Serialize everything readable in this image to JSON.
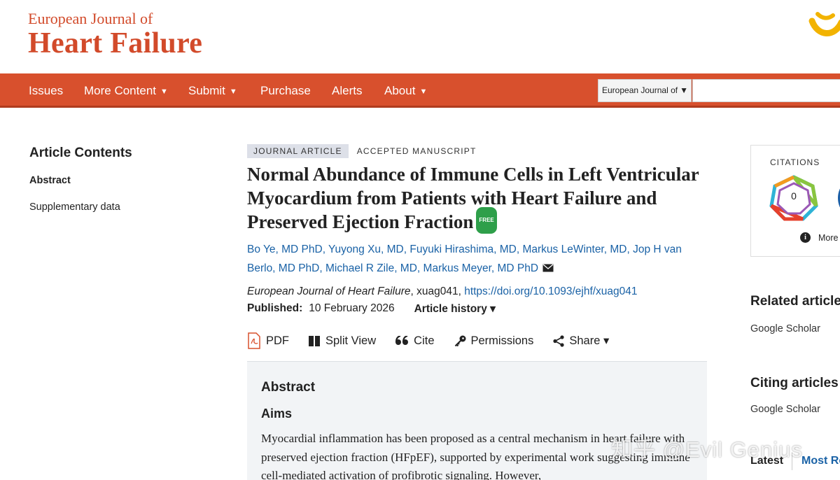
{
  "header": {
    "logo_small": "European Journal of",
    "logo_big": "Heart Failure"
  },
  "nav": {
    "items": [
      {
        "label": "Issues"
      },
      {
        "label": "More Content"
      },
      {
        "label": "Submit"
      },
      {
        "label": "Purchase"
      },
      {
        "label": "Alerts"
      },
      {
        "label": "About"
      }
    ],
    "search_scope": "European Journal of",
    "search_value": ""
  },
  "toc": {
    "title": "Article Contents",
    "items": [
      "Abstract",
      "Supplementary data"
    ]
  },
  "article": {
    "badge_type": "JOURNAL ARTICLE",
    "badge_status": "ACCEPTED MANUSCRIPT",
    "title": "Normal Abundance of Immune Cells in Left Ventricular Myocardium from Patients with Heart Failure and Preserved Ejection Fraction",
    "free_label": "FREE",
    "authors": [
      "Bo Ye, MD PhD",
      "Yuyong Xu, MD",
      "Fuyuki Hirashima, MD",
      "Markus LeWinter, MD",
      "Jop H van Berlo, MD PhD",
      "Michael R Zile, MD",
      "Markus Meyer, MD PhD"
    ],
    "journal": "European Journal of Heart Failure",
    "article_id": ", xuag041, ",
    "doi": "https://doi.org/10.1093/ejhf/xuag041",
    "published_label": "Published:",
    "published_date": "10 February 2026",
    "history_label": "Article history ▾"
  },
  "tools": {
    "pdf": "PDF",
    "split": "Split View",
    "cite": "Cite",
    "permissions": "Permissions",
    "share": "Share ▾"
  },
  "abstract": {
    "heading": "Abstract",
    "subheading": "Aims",
    "text": "Myocardial inflammation has been proposed as a central mechanism in heart failure with preserved ejection fraction (HFpEF), supported by experimental work suggesting immune cell-mediated activation of profibrotic signaling. However,"
  },
  "sidebar_right": {
    "citations_label": "CITATIONS",
    "citations_count": "0",
    "more_metrics": "More metrics",
    "related_heading": "Related articles",
    "related_link": "Google Scholar",
    "citing_heading": "Citing articles",
    "citing_link": "Google Scholar",
    "tab_latest": "Latest",
    "tab_most": "Most Read"
  },
  "watermark": "知乎 @Evil Genius",
  "colors": {
    "brand": "#d8502d",
    "link": "#1a62a6",
    "free": "#2e9f4a"
  }
}
